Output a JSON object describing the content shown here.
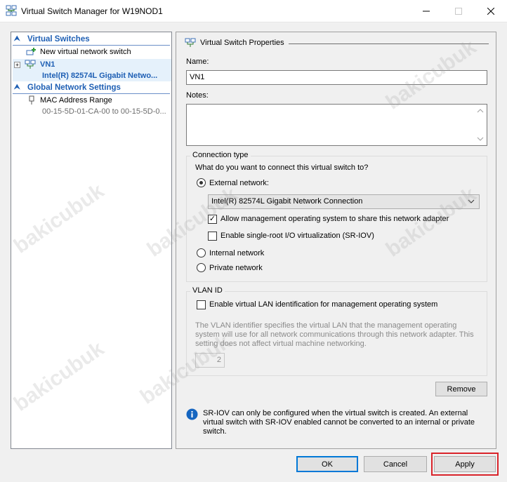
{
  "window": {
    "title": "Virtual Switch Manager for W19NOD1",
    "icon": "virtual-switch-manager-icon"
  },
  "tree": {
    "virtual_switches_header": "Virtual Switches",
    "new_switch": "New virtual network switch",
    "switch_name": "VN1",
    "switch_adapter": "Intel(R) 82574L Gigabit Netwo...",
    "global_header": "Global Network Settings",
    "mac_range_label": "MAC Address Range",
    "mac_range_value": "00-15-5D-01-CA-00 to 00-15-5D-0..."
  },
  "properties": {
    "title": "Virtual Switch Properties",
    "name_label": "Name:",
    "name_value": "VN1",
    "notes_label": "Notes:",
    "notes_value": "",
    "connection_type": {
      "group_label": "Connection type",
      "question": "What do you want to connect this virtual switch to?",
      "external_label": "External network:",
      "external_selected": true,
      "adapter_selected": "Intel(R) 82574L Gigabit Network Connection",
      "allow_mgmt_label": "Allow management operating system to share this network adapter",
      "allow_mgmt_checked": true,
      "sriov_label": "Enable single-root I/O virtualization (SR-IOV)",
      "sriov_checked": false,
      "internal_label": "Internal network",
      "private_label": "Private network"
    },
    "vlan": {
      "group_label": "VLAN ID",
      "enable_label": "Enable virtual LAN identification for management operating system",
      "enable_checked": false,
      "description": "The VLAN identifier specifies the virtual LAN that the management operating system will use for all network communications through this network adapter. This setting does not affect virtual machine networking.",
      "vlan_value": "2"
    },
    "remove_label": "Remove",
    "info_text": "SR-IOV can only be configured when the virtual switch is created. An external virtual switch with SR-IOV enabled cannot be converted to an internal or private switch."
  },
  "buttons": {
    "ok": "OK",
    "cancel": "Cancel",
    "apply": "Apply"
  },
  "colors": {
    "accent": "#0078d7",
    "tree_header": "#1e5fb4",
    "apply_highlight": "#d9232a",
    "info_icon": "#1565c0"
  },
  "watermark": "bakicubuk"
}
